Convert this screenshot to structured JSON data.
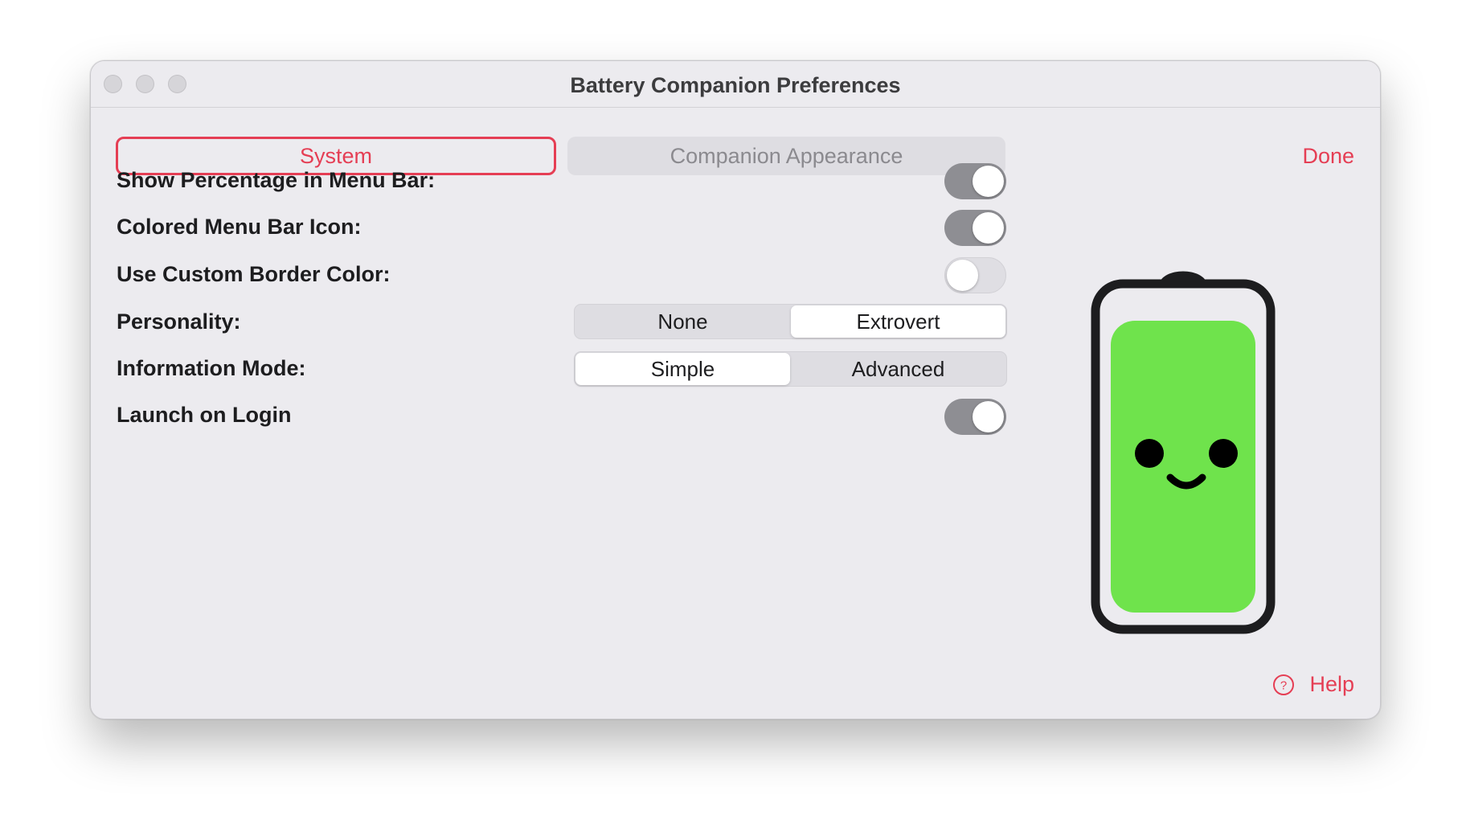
{
  "window": {
    "title": "Battery Companion Preferences"
  },
  "tabs": {
    "system": "System",
    "appearance": "Companion Appearance",
    "selected": "System"
  },
  "done_label": "Done",
  "settings": {
    "show_percentage": {
      "label": "Show Percentage in Menu Bar:",
      "value": true
    },
    "colored_icon": {
      "label": "Colored Menu Bar Icon:",
      "value": true
    },
    "custom_border": {
      "label": "Use Custom Border Color:",
      "value": false
    },
    "personality": {
      "label": "Personality:",
      "options": [
        "None",
        "Extrovert"
      ],
      "selected": "Extrovert"
    },
    "info_mode": {
      "label": "Information Mode:",
      "options": [
        "Simple",
        "Advanced"
      ],
      "selected": "Simple"
    },
    "launch_login": {
      "label": "Launch on Login",
      "value": true
    }
  },
  "companion": {
    "battery_fill_color": "#6fe34c",
    "frame_color": "#1d1d1f",
    "fill_level": 1.0
  },
  "help_label": "Help",
  "colors": {
    "accent": "#e53e54"
  }
}
